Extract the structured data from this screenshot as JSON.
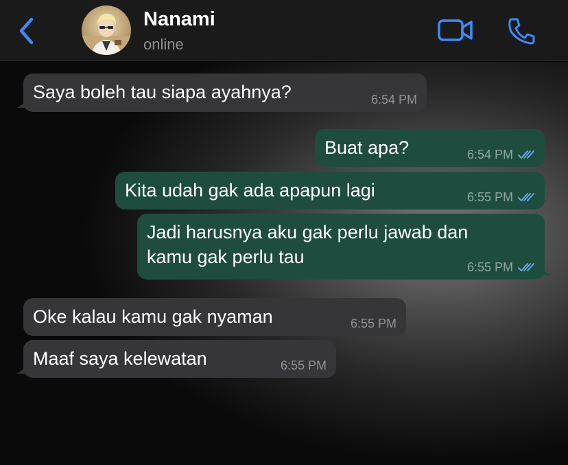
{
  "header": {
    "contact_name": "Nanami",
    "status": "online",
    "back_icon": "chevron-left-icon",
    "video_icon": "video-camera-icon",
    "call_icon": "phone-icon",
    "accent_color": "#3d8bfd"
  },
  "messages": [
    {
      "direction": "incoming",
      "text": "Saya boleh tau siapa ayahnya?",
      "time": "6:54 PM"
    },
    {
      "direction": "outgoing",
      "text": "Buat apa?",
      "time": "6:54 PM",
      "read": true
    },
    {
      "direction": "outgoing",
      "text": "Kita udah gak ada apapun lagi",
      "time": "6:55 PM",
      "read": true
    },
    {
      "direction": "outgoing",
      "text": "Jadi harusnya aku gak perlu jawab dan\nkamu gak perlu tau",
      "time": "6:55 PM",
      "read": true
    },
    {
      "direction": "incoming",
      "text": "Oke kalau kamu gak nyaman",
      "time": "6:55 PM"
    },
    {
      "direction": "incoming",
      "text": "Maaf saya kelewatan",
      "time": "6:55 PM"
    }
  ],
  "colors": {
    "incoming_bubble": "#363638",
    "outgoing_bubble": "#1e4d3f",
    "read_ticks": "#5fa8e8"
  }
}
